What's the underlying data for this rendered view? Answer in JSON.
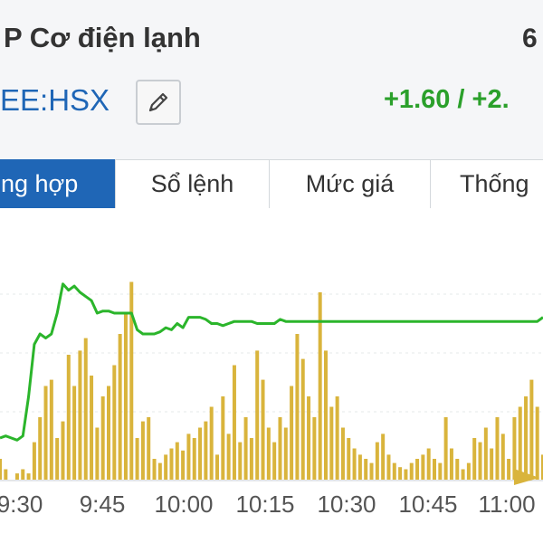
{
  "header": {
    "company_name": "P Cơ điện lạnh",
    "price": "6",
    "ticker": "EE:HSX",
    "change": "+1.60 / +2.",
    "edit_icon": "pencil-icon"
  },
  "tabs": [
    {
      "label": "ng hợp",
      "active": true
    },
    {
      "label": "Sổ lệnh",
      "active": false
    },
    {
      "label": "Mức giá",
      "active": false
    },
    {
      "label": "Thống",
      "active": false
    }
  ],
  "colors": {
    "price_line": "#2bb52b",
    "volume_bar": "#d9b43c",
    "tab_active": "#1f66b6",
    "change_text": "#2ba02b"
  },
  "chart_data": {
    "type": "line",
    "x_ticks": [
      "9:30",
      "9:45",
      "10:00",
      "10:15",
      "10:30",
      "10:45",
      "11:00"
    ],
    "price_series_x_minutes": [
      0,
      1,
      2,
      3,
      4,
      5,
      6,
      7,
      8,
      9,
      10,
      11,
      12,
      13,
      14,
      15,
      16,
      17,
      18,
      19,
      20,
      21,
      22,
      23,
      24,
      25,
      26,
      27,
      28,
      29,
      30,
      31,
      32,
      33,
      34,
      35,
      36,
      37,
      38,
      39,
      40,
      41,
      42,
      43,
      44,
      45,
      46,
      47,
      48,
      49,
      50,
      51,
      52,
      53,
      54,
      55,
      56,
      57,
      58,
      59,
      60,
      61,
      62,
      63,
      64,
      65,
      66,
      67,
      68,
      69,
      70,
      71,
      72,
      73,
      74,
      75,
      76,
      77,
      78,
      79,
      80,
      81,
      82,
      83,
      84,
      85,
      86,
      87,
      88,
      89,
      90,
      91,
      92,
      93,
      94,
      95
    ],
    "price_levels": [
      20,
      21,
      20,
      19,
      21,
      40,
      65,
      70,
      68,
      70,
      80,
      94,
      91,
      93,
      90,
      88,
      86,
      80,
      81,
      81,
      80,
      80,
      80,
      80,
      72,
      70,
      70,
      70,
      71,
      73,
      72,
      75,
      73,
      78,
      78,
      78,
      77,
      75,
      75,
      74,
      75,
      76,
      76,
      76,
      76,
      75,
      75,
      75,
      75,
      77,
      76,
      76,
      76,
      76,
      76,
      76,
      76,
      76,
      76,
      76,
      76,
      76,
      76,
      76,
      76,
      76,
      76,
      76,
      76,
      76,
      76,
      76,
      76,
      76,
      76,
      76,
      76,
      76,
      76,
      76,
      76,
      76,
      76,
      76,
      76,
      76,
      76,
      76,
      76,
      76,
      76,
      76,
      76,
      76,
      76,
      78
    ],
    "volume_levels": [
      10,
      5,
      0,
      3,
      5,
      3,
      18,
      30,
      45,
      48,
      20,
      28,
      60,
      45,
      62,
      68,
      50,
      25,
      40,
      45,
      55,
      70,
      80,
      95,
      20,
      28,
      30,
      10,
      8,
      12,
      15,
      18,
      14,
      22,
      20,
      25,
      28,
      35,
      12,
      40,
      22,
      55,
      18,
      30,
      20,
      62,
      48,
      25,
      18,
      30,
      25,
      45,
      70,
      58,
      40,
      30,
      90,
      62,
      35,
      40,
      25,
      20,
      15,
      12,
      10,
      8,
      18,
      22,
      12,
      8,
      6,
      5,
      8,
      10,
      12,
      15,
      10,
      8,
      30,
      15,
      10,
      5,
      8,
      20,
      18,
      25,
      15,
      30,
      22,
      10,
      30,
      35,
      40,
      48,
      35,
      12
    ],
    "ylim": [
      0,
      100
    ]
  }
}
